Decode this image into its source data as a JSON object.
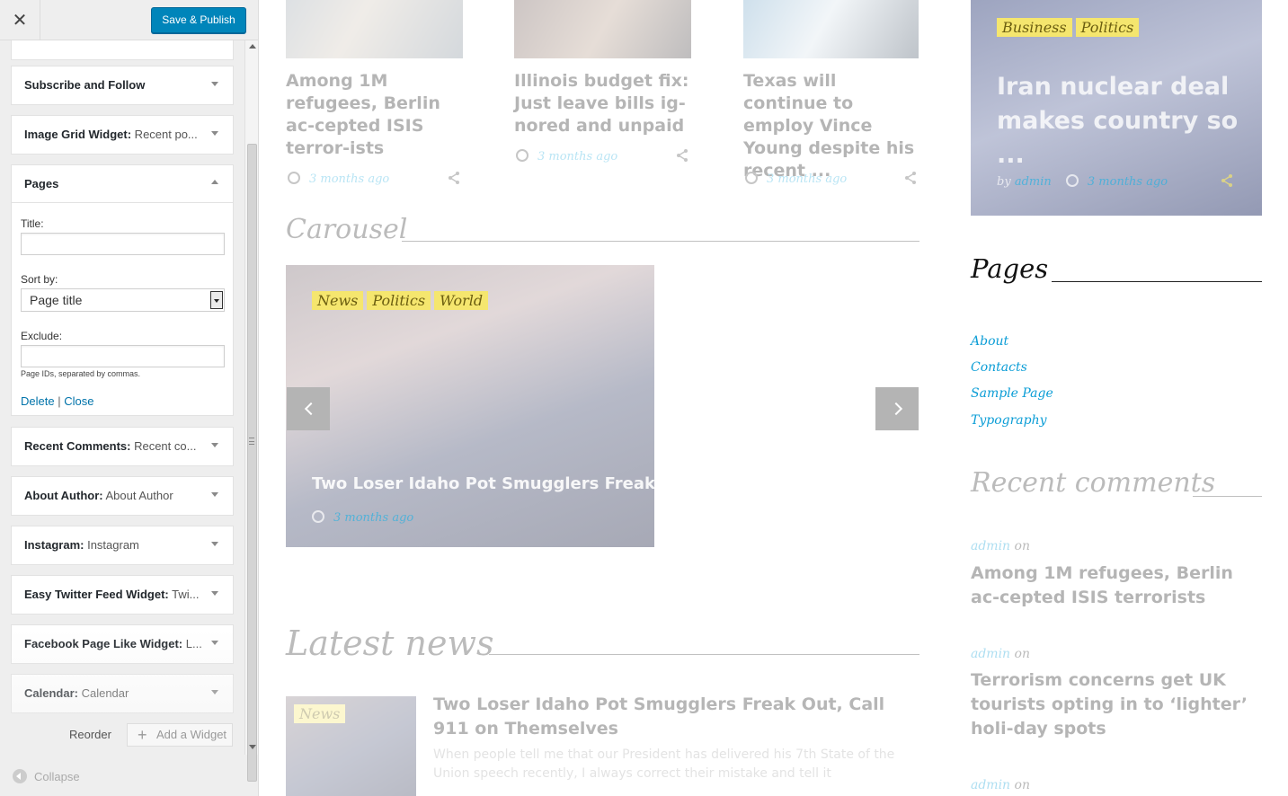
{
  "sidebar": {
    "close_label": "✕",
    "publish_label": "Save & Publish",
    "widgets_above": [
      {
        "name": "Subscribe and Follow",
        "sub": ""
      },
      {
        "name": "Image Grid Widget:",
        "sub": " Recent po..."
      }
    ],
    "pages_widget": {
      "name": "Pages",
      "title_label": "Title:",
      "title_value": "",
      "sortby_label": "Sort by:",
      "sortby_value": "Page title",
      "exclude_label": "Exclude:",
      "exclude_value": "",
      "hint": "Page IDs, separated by commas.",
      "delete_label": "Delete",
      "separator": "|",
      "close_label": "Close"
    },
    "widgets_below": [
      {
        "name": "Recent Comments:",
        "sub": " Recent co..."
      },
      {
        "name": "About Author:",
        "sub": " About Author"
      },
      {
        "name": "Instagram:",
        "sub": " Instagram"
      },
      {
        "name": "Easy Twitter Feed Widget:",
        "sub": " Twi..."
      },
      {
        "name": "Facebook Page Like Widget:",
        "sub": " L..."
      },
      {
        "name": "Calendar:",
        "sub": " Calendar"
      }
    ],
    "reorder_label": "Reorder",
    "add_widget_label": "Add a Widget",
    "collapse_label": "Collapse"
  },
  "preview": {
    "top_posts": [
      {
        "title": "Among 1M refugees, Berlin ac-cepted ISIS terror-ists",
        "meta": "3 months ago"
      },
      {
        "title": "Illinois budget fix: Just leave bills ig-nored and unpaid",
        "meta": "3 months ago"
      },
      {
        "title": "Texas will continue to employ Vince Young despite his recent ...",
        "meta": "3 months ago"
      }
    ],
    "featured": {
      "tags": [
        "Business",
        "Politics"
      ],
      "title": "Iran nuclear deal makes country so ...",
      "by": "by",
      "author": "admin",
      "meta": "3 months ago"
    },
    "carousel": {
      "heading": "Carousel",
      "tags": [
        "News",
        "Politics",
        "World"
      ],
      "title": "Two Loser Idaho Pot Smugglers Freak O",
      "meta": "3 months ago"
    },
    "latest": {
      "heading": "Latest news",
      "tag": "News",
      "title": "Two Loser Idaho Pot Smugglers Freak Out, Call 911 on Themselves",
      "excerpt": "When people tell me that our President has delivered his 7th State of the Union speech recently, I always correct their mistake and tell it"
    },
    "pages_widget": {
      "heading": "Pages",
      "links": [
        "About",
        "Contacts",
        "Sample Page",
        "Typography"
      ]
    },
    "recent_comments": {
      "heading": "Recent comments",
      "items": [
        {
          "author": "admin",
          "on": "on",
          "post": "Among 1M refugees, Berlin ac-cepted ISIS terrorists"
        },
        {
          "author": "admin",
          "on": "on",
          "post": "Terrorism concerns get UK tourists opting in to ‘lighter’ holi-day spots"
        },
        {
          "author": "admin",
          "on": "on",
          "post": ""
        }
      ]
    }
  },
  "colors": {
    "publish": "#0085ba",
    "link": "#0b9dd6",
    "tag": "#f5e66e"
  }
}
